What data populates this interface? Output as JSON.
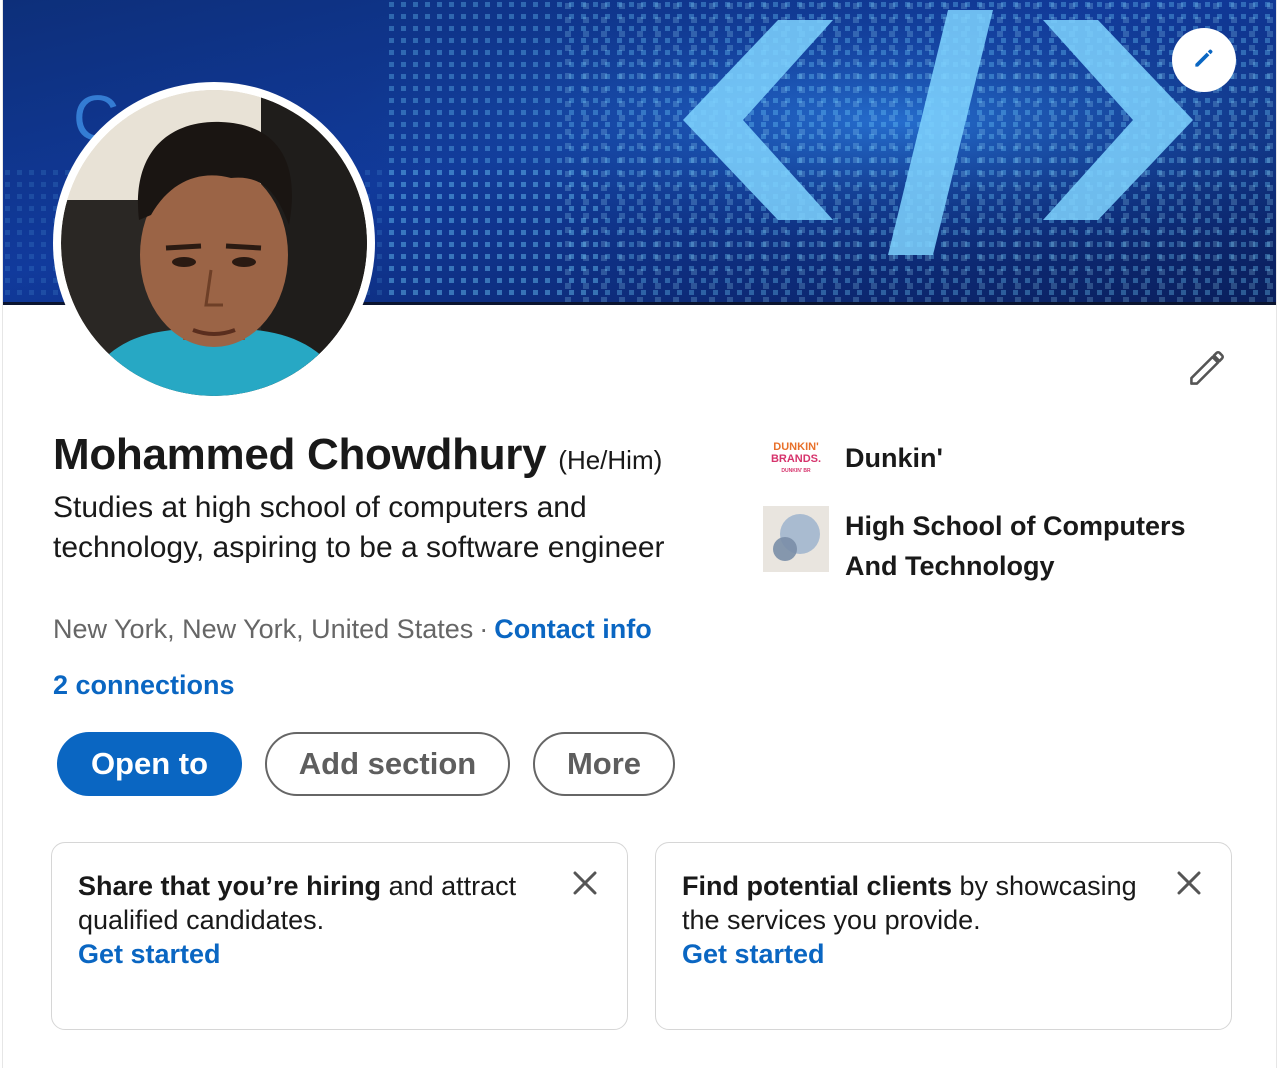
{
  "profile": {
    "name": "Mohammed Chowdhury",
    "pronouns": "(He/Him)",
    "headline": "Studies at high school of computers and technology, aspiring to be a software engineer",
    "location": "New York, New York, United States",
    "separator": "·",
    "contact_info_label": "Contact info",
    "connections_label": "2 connections"
  },
  "actions": {
    "open_to": "Open to",
    "add_section": "Add section",
    "more": "More"
  },
  "organizations": [
    {
      "name": "Dunkin'",
      "logo_text_line1": "DUNKIN'",
      "logo_text_line2": "BRANDS.",
      "logo_text_line3": "DUNKIN' BR"
    },
    {
      "name": "High School of Computers And Technology"
    }
  ],
  "promos": [
    {
      "bold": "Share that you’re hiring",
      "rest": " and attract qualified candidates.",
      "link": "Get started"
    },
    {
      "bold": "Find potential clients",
      "rest": " by showcasing the services you provide.",
      "link": "Get started"
    }
  ],
  "icons": {
    "banner_edit": "pencil-icon",
    "intro_edit": "pencil-icon",
    "close": "close-icon"
  },
  "colors": {
    "brand_blue": "#0a66c2",
    "text": "#191919",
    "muted": "#666666",
    "banner_dark": "#0b1a4a",
    "banner_glow": "#5fc8ff"
  }
}
